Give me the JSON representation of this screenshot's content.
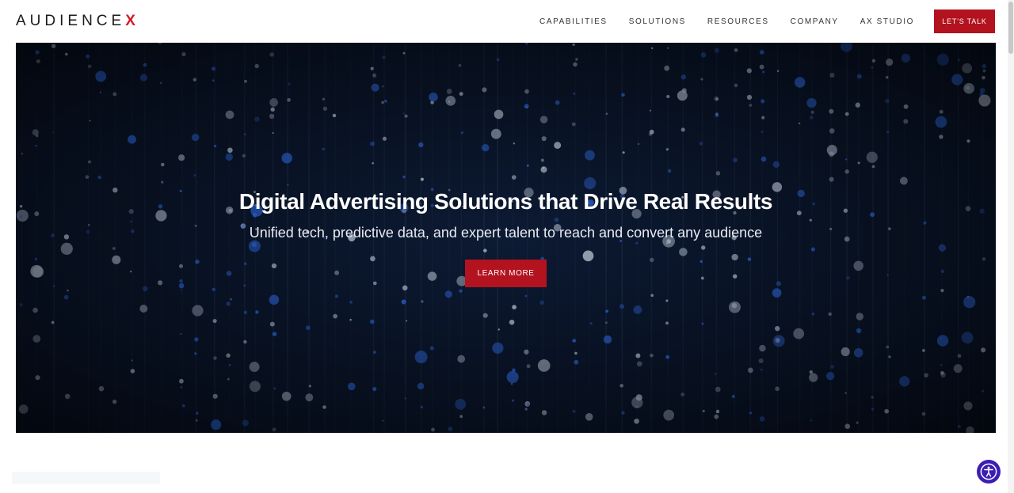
{
  "header": {
    "logo_text": "AUDIENCE",
    "logo_accent": "X",
    "nav": [
      "CAPABILITIES",
      "SOLUTIONS",
      "RESOURCES",
      "COMPANY",
      "AX STUDIO"
    ],
    "cta_label": "LET'S TALK"
  },
  "hero": {
    "title": "Digital Advertising Solutions that Drive Real Results",
    "subtitle": "Unified tech, predictive data, and expert talent to reach and convert any audience",
    "button_label": "LEARN MORE"
  },
  "overlay": {
    "faint_text": ""
  },
  "icons": {
    "accessibility": "accessibility-icon"
  },
  "colors": {
    "brand_red": "#b3121f",
    "logo_accent": "#d21b27",
    "hero_bg": "#08101f",
    "accessibility": "#3c1db3"
  }
}
